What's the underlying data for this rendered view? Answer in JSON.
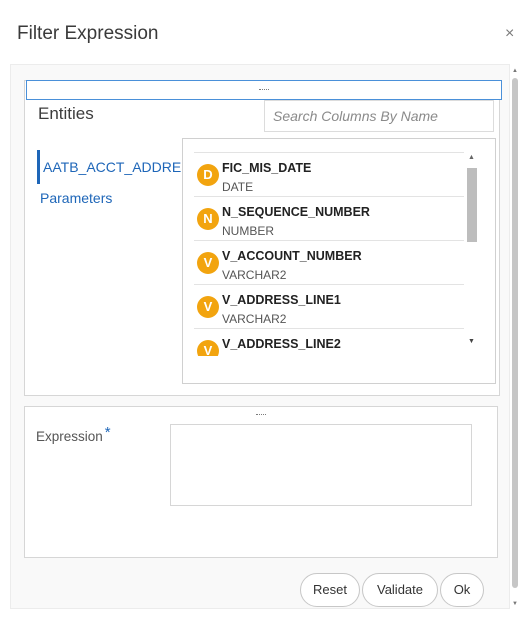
{
  "dialog": {
    "title": "Filter Expression",
    "close_glyph": "×"
  },
  "entities": {
    "label": "Entities",
    "items": [
      {
        "label": "AATB_ACCT_ADDRESS",
        "selected": true
      },
      {
        "label": "Parameters",
        "selected": false
      }
    ]
  },
  "search": {
    "placeholder": "Search Columns By Name",
    "value": ""
  },
  "columns": [
    {
      "badge": "D",
      "name": "FIC_MIS_DATE",
      "type": "DATE"
    },
    {
      "badge": "N",
      "name": "N_SEQUENCE_NUMBER",
      "type": "NUMBER"
    },
    {
      "badge": "V",
      "name": "V_ACCOUNT_NUMBER",
      "type": "VARCHAR2"
    },
    {
      "badge": "V",
      "name": "V_ADDRESS_LINE1",
      "type": "VARCHAR2"
    },
    {
      "badge": "V",
      "name": "V_ADDRESS_LINE2",
      "type": ""
    }
  ],
  "expression": {
    "label": "Expression",
    "required_mark": "*",
    "value": ""
  },
  "buttons": {
    "reset": "Reset",
    "validate": "Validate",
    "ok": "Ok"
  },
  "colors": {
    "accent": "#1e66b8",
    "badge": "#f2a40f",
    "splitter_focus": "#4a90d9"
  }
}
